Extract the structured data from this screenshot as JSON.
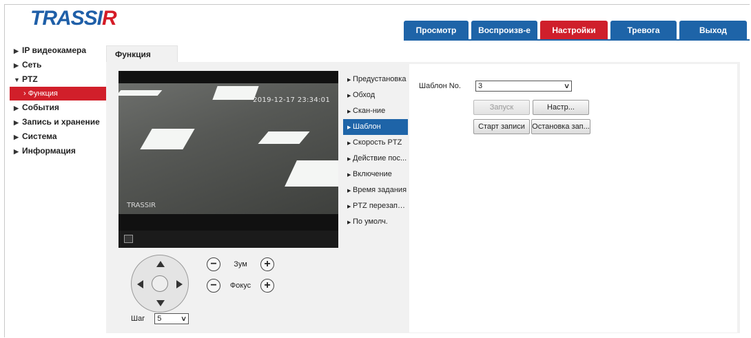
{
  "app": {
    "logo_main": "TRASSI",
    "logo_accent": "R"
  },
  "topnav": [
    {
      "label": "Просмотр",
      "active": false
    },
    {
      "label": "Воспроизв-е",
      "active": false
    },
    {
      "label": "Настройки",
      "active": true
    },
    {
      "label": "Тревога",
      "active": false
    },
    {
      "label": "Выход",
      "active": false
    }
  ],
  "sidebar": {
    "items": [
      {
        "label": "IP видеокамера",
        "expanded": false
      },
      {
        "label": "Сеть",
        "expanded": false
      },
      {
        "label": "PTZ",
        "expanded": true
      },
      {
        "label": "События",
        "expanded": false
      },
      {
        "label": "Запись и хранение",
        "expanded": false
      },
      {
        "label": "Система",
        "expanded": false
      },
      {
        "label": "Информация",
        "expanded": false
      }
    ],
    "sub_item": "Функция"
  },
  "content": {
    "tab": "Функция"
  },
  "video": {
    "timestamp": "2019-12-17 23:34:01",
    "watermark": "TRASSIR"
  },
  "ptz": {
    "zoom_label": "Зум",
    "focus_label": "Фокус",
    "step_label": "Шаг",
    "step_value": "5",
    "minus": "−",
    "plus": "+"
  },
  "function_list": [
    {
      "label": "Предустановка",
      "active": false
    },
    {
      "label": "Обход",
      "active": false
    },
    {
      "label": "Скан-ние",
      "active": false
    },
    {
      "label": "Шаблон",
      "active": true
    },
    {
      "label": "Скорость PTZ",
      "active": false
    },
    {
      "label": "Действие пос...",
      "active": false
    },
    {
      "label": "Включение",
      "active": false
    },
    {
      "label": "Время задания",
      "active": false
    },
    {
      "label": "PTZ перезапуск",
      "active": false
    },
    {
      "label": "По умолч.",
      "active": false
    }
  ],
  "pattern": {
    "label": "Шаблон No.",
    "value": "3",
    "buttons": {
      "start": "Запуск",
      "setup": "Настр...",
      "start_record": "Старт записи",
      "stop_record": "Остановка зап..."
    }
  },
  "colors": {
    "nav_blue": "#1e64a8",
    "nav_red": "#cf1f2b",
    "panel_grey": "#f1f1f1"
  }
}
